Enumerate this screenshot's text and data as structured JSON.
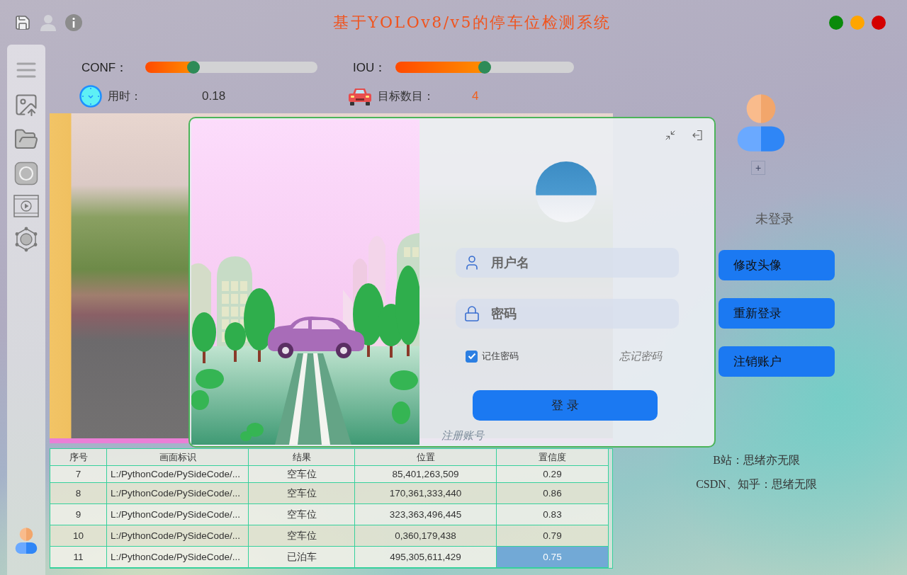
{
  "window": {
    "title": "基于YOLOv8/v5的停车位检测系统",
    "controls": [
      {
        "color": "#0a8a0a"
      },
      {
        "color": "#ffa500"
      },
      {
        "color": "#d40000"
      }
    ]
  },
  "sliders": [
    {
      "label": "CONF：",
      "level": 0.28
    },
    {
      "label": "IOU：",
      "level": 0.5
    }
  ],
  "stats": [
    {
      "kind": "time",
      "label": "用时：",
      "value": "0.18"
    },
    {
      "kind": "count",
      "label": "目标数目：",
      "value": "4"
    }
  ],
  "table": {
    "columns": [
      "序号",
      "画面标识",
      "结果",
      "位置",
      "置信度"
    ],
    "rows": [
      {
        "cells": [
          "7",
          "L:/PythonCode/PySideCode/...",
          "空车位",
          "85,401,263,509",
          "0.29"
        ],
        "selected": false
      },
      {
        "cells": [
          "8",
          "L:/PythonCode/PySideCode/...",
          "空车位",
          "170,361,333,440",
          "0.86"
        ],
        "selected": false
      },
      {
        "cells": [
          "9",
          "L:/PythonCode/PySideCode/...",
          "空车位",
          "323,363,496,445",
          "0.83"
        ],
        "selected": false
      },
      {
        "cells": [
          "10",
          "L:/PythonCode/PySideCode/...",
          "空车位",
          "0,360,179,438",
          "0.79"
        ],
        "selected": false
      },
      {
        "cells": [
          "11",
          "L:/PythonCode/PySideCode/...",
          "已泊车",
          "495,305,611,429",
          "0.75"
        ],
        "selected": true
      }
    ]
  },
  "login": {
    "username": {
      "placeholder": "用户名"
    },
    "password": {
      "placeholder": "密码"
    },
    "remember": {
      "label": "记住密码",
      "checked": true
    },
    "forgot": "忘记密码",
    "submit": "登 录",
    "register": "注册账号"
  },
  "profile": {
    "add_label": "+",
    "status": "未登录",
    "buttons": [
      "修改头像",
      "重新登录",
      "注销账户"
    ],
    "credits": [
      "B站：思绪亦无限",
      "CSDN、知乎：思绪无限"
    ]
  }
}
